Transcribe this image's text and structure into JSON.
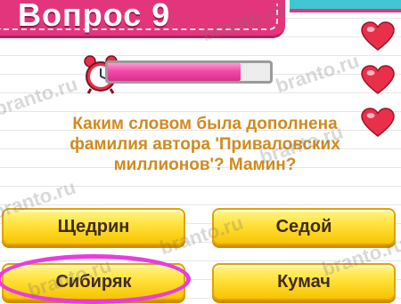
{
  "header": {
    "title": "Вопрос 9"
  },
  "timer": {
    "remaining_fraction": 0.82
  },
  "lives": {
    "count": 3,
    "icon": "heart-icon",
    "color": "#e8304a"
  },
  "question": {
    "text": "Каким словом была дополнена фамилия автора 'Приваловских миллионов'? Мамин?"
  },
  "answers": [
    {
      "label": "Щедрин"
    },
    {
      "label": "Седой"
    },
    {
      "label": "Сибиряк"
    },
    {
      "label": "Кумач"
    }
  ],
  "highlighted_answer": "Сибиряк",
  "watermark": {
    "text": "branto.ru"
  },
  "colors": {
    "header_pink": "#e2357c",
    "header_teal": "#3fc6d1",
    "question_text": "#d18a1e",
    "answer_yellow": "#ffe13a",
    "timer_fill": "#f24aa8",
    "highlight_ring": "#e83ce0"
  }
}
